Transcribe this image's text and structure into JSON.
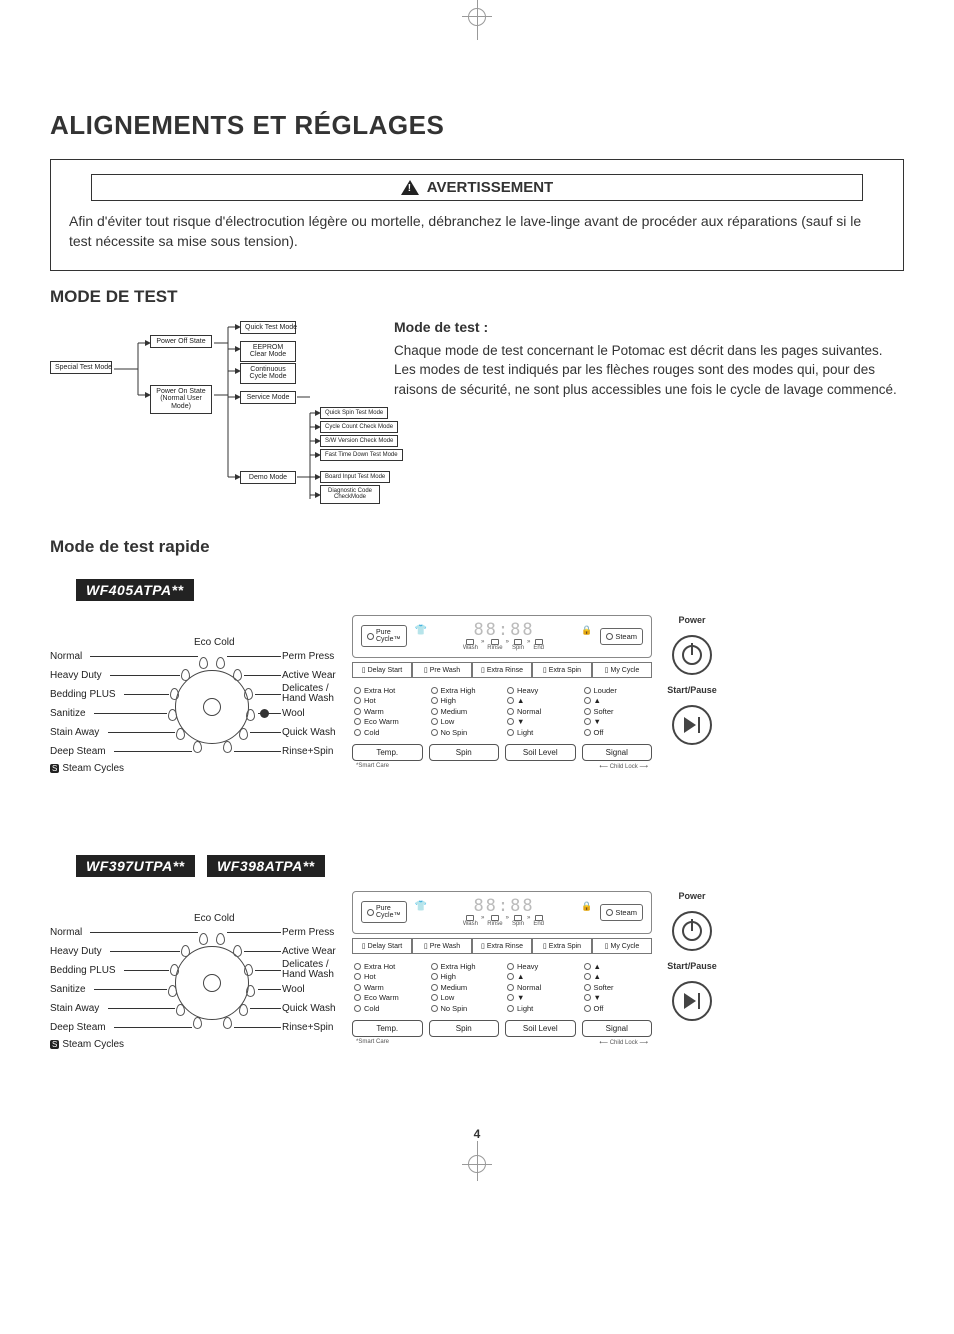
{
  "page": {
    "title": "ALIGNEMENTS ET RÉGLAGES",
    "warning_label": "AVERTISSEMENT",
    "warning_text": "Afin d'éviter tout risque d'électrocution légère ou mortelle, débranchez le lave-linge avant de procéder aux réparations (sauf si le test nécessite sa mise sous tension).",
    "mode_test_heading": "MODE DE TEST",
    "mode_test_label": "Mode de test :",
    "mode_test_desc": "Chaque mode de test concernant le Potomac est décrit dans les pages suivantes.  Les modes de test indiqués par les flèches rouges sont des modes qui, pour des raisons de sécurité, ne sont plus accessibles une fois le cycle de lavage commencé.",
    "quick_test_heading": "Mode de test rapide",
    "models": {
      "a": "WF405ATPA**",
      "b": "WF397UTPA**",
      "c": "WF398ATPA**"
    },
    "pagenum": "4"
  },
  "flow": {
    "special": "Special Test Mode",
    "poweroff": "Power Off State",
    "poweron": "Power On State\n(Normal User Mode)",
    "quick": "Quick Test Mode",
    "eeprom": "EEPROM Clear\nMode",
    "cont": "Continuous Cycle\nMode",
    "service": "Service Mode",
    "demo": "Demo Mode",
    "quickspin": "Quick Spin Test Mode",
    "cyclecount": "Cycle Count Check Mode",
    "swver": "S/W Version Check Mode",
    "fasttime": "Fast Time Down Test Mode",
    "boardin": "Board Input Test Mode",
    "diag": "Diagnostic Code\nCheckMode"
  },
  "dial": {
    "left": [
      "Normal",
      "Heavy Duty",
      "Bedding PLUS",
      "Sanitize",
      "Stain Away",
      "Deep Steam"
    ],
    "leftfoot": "Steam Cycles",
    "center_top": "Eco Cold",
    "right": [
      "Perm Press",
      "Active Wear",
      "Delicates /\nHand Wash",
      "Wool",
      "Quick Wash",
      "Rinse+Spin"
    ]
  },
  "cp": {
    "pure": "Pure\nCycle™",
    "steam": "Steam",
    "segment": "88:88",
    "stages": [
      "Wash",
      "Rinse",
      "Spin",
      "End"
    ],
    "row": [
      "Delay Start",
      "Pre Wash",
      "Extra Rinse",
      "Extra Spin",
      "My Cycle"
    ],
    "col1": [
      "Extra Hot",
      "Hot",
      "Warm",
      "Eco Warm",
      "Cold"
    ],
    "col2": [
      "Extra High",
      "High",
      "Medium",
      "Low",
      "No Spin"
    ],
    "col3": [
      "Heavy",
      "▲",
      "Normal",
      "▼",
      "Light"
    ],
    "col4a": [
      "Louder",
      "▲",
      "Softer",
      "▼",
      "Off"
    ],
    "col4b": [
      "▲",
      "▲",
      "Softer",
      "▼",
      "Off"
    ],
    "btns": [
      "Temp.",
      "Spin",
      "Soil Level",
      "Signal"
    ],
    "footL": "*Smart Care",
    "footR": "Child Lock"
  },
  "side": {
    "power": "Power",
    "start": "Start/Pause"
  }
}
